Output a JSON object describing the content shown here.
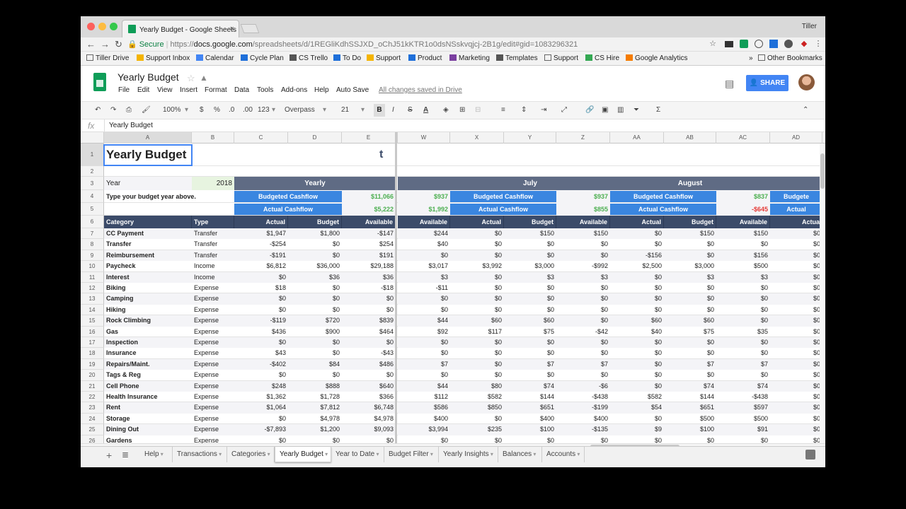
{
  "browser": {
    "tab_title": "Yearly Budget - Google Sheets",
    "profile": "Tiller",
    "secure_label": "Secure",
    "url_scheme": "https://",
    "url_host": "docs.google.com",
    "url_path": "/spreadsheets/d/1REGliKdhSSJXD_oChJ51kKTR1o0dsNSskvqjcj-2B1g/edit#gid=1083296321"
  },
  "bookmarks": [
    "Tiller Drive",
    "Support Inbox",
    "Calendar",
    "Cycle Plan",
    "CS Trello",
    "To Do",
    "Support",
    "Product",
    "Marketing",
    "Templates",
    "Support",
    "CS Hire",
    "Google Analytics"
  ],
  "bookmarks_more": "»",
  "other_bookmarks": "Other Bookmarks",
  "doc": {
    "title": "Yearly Budget",
    "menu": [
      "File",
      "Edit",
      "View",
      "Insert",
      "Format",
      "Data",
      "Tools",
      "Add-ons",
      "Help",
      "Auto Save"
    ],
    "saved": "All changes saved in Drive",
    "share": "SHARE"
  },
  "toolbar": {
    "zoom": "100%",
    "currency": "$",
    "percent": "%",
    "dec_less": ".0",
    "dec_more": ".00",
    "format": "123",
    "font": "Overpass",
    "size": "21",
    "bold": "B",
    "italic": "I",
    "strike": "S",
    "textcolor": "A"
  },
  "formula_bar": {
    "fx": "fx",
    "value": "Yearly Budget"
  },
  "columns": [
    "A",
    "B",
    "C",
    "D",
    "E",
    "W",
    "X",
    "Y",
    "Z",
    "AA",
    "AB",
    "AC",
    "AD"
  ],
  "row_numbers": [
    "1",
    "2",
    "3",
    "4",
    "5",
    "6",
    "7",
    "8",
    "9",
    "10",
    "11",
    "12",
    "13",
    "14",
    "15",
    "16",
    "17",
    "18",
    "19",
    "20",
    "21",
    "22",
    "23",
    "24",
    "25",
    "26"
  ],
  "sheet": {
    "title": "Yearly Budget",
    "logo": "t",
    "year_label": "Year",
    "year_value": "2018",
    "hint": "Type your budget year above.",
    "section_yearly": "Yearly",
    "section_july": "July",
    "section_august": "August",
    "budgeted_cashflow": "Budgeted Cashflow",
    "actual_cashflow": "Actual Cashflow",
    "budgeted_trunc": "Budgete",
    "actual_trunc": "Actual",
    "yearly_budgeted_val": "$11,066",
    "yearly_actual_val": "$5,222",
    "w_budgeted_val": "$937",
    "w_actual_val": "$1,992",
    "july_budgeted_val": "$937",
    "july_actual_val": "$855",
    "aug_budgeted_val": "$837",
    "aug_actual_val": "-$645",
    "headers": [
      "Category",
      "Type",
      "Actual",
      "Budget",
      "Available",
      "Available",
      "Actual",
      "Budget",
      "Available",
      "Actual",
      "Budget",
      "Available",
      "Actua"
    ],
    "rows": [
      [
        "CC Payment",
        "Transfer",
        "$1,947",
        "$1,800",
        "-$147",
        "$244",
        "$0",
        "$150",
        "$150",
        "$0",
        "$150",
        "$150",
        "$0"
      ],
      [
        "Transfer",
        "Transfer",
        "-$254",
        "$0",
        "$254",
        "$40",
        "$0",
        "$0",
        "$0",
        "$0",
        "$0",
        "$0",
        "$0"
      ],
      [
        "Reimbursement",
        "Transfer",
        "-$191",
        "$0",
        "$191",
        "$0",
        "$0",
        "$0",
        "$0",
        "-$156",
        "$0",
        "$156",
        "$0"
      ],
      [
        "Paycheck",
        "Income",
        "$6,812",
        "$36,000",
        "$29,188",
        "$3,017",
        "$3,992",
        "$3,000",
        "-$992",
        "$2,500",
        "$3,000",
        "$500",
        "$0"
      ],
      [
        "Interest",
        "Income",
        "$0",
        "$36",
        "$36",
        "$3",
        "$0",
        "$3",
        "$3",
        "$0",
        "$3",
        "$3",
        "$0"
      ],
      [
        "Biking",
        "Expense",
        "$18",
        "$0",
        "-$18",
        "-$11",
        "$0",
        "$0",
        "$0",
        "$0",
        "$0",
        "$0",
        "$0"
      ],
      [
        "Camping",
        "Expense",
        "$0",
        "$0",
        "$0",
        "$0",
        "$0",
        "$0",
        "$0",
        "$0",
        "$0",
        "$0",
        "$0"
      ],
      [
        "Hiking",
        "Expense",
        "$0",
        "$0",
        "$0",
        "$0",
        "$0",
        "$0",
        "$0",
        "$0",
        "$0",
        "$0",
        "$0"
      ],
      [
        "Rock Climbing",
        "Expense",
        "-$119",
        "$720",
        "$839",
        "$44",
        "$60",
        "$60",
        "$0",
        "$60",
        "$60",
        "$0",
        "$0"
      ],
      [
        "Gas",
        "Expense",
        "$436",
        "$900",
        "$464",
        "$92",
        "$117",
        "$75",
        "-$42",
        "$40",
        "$75",
        "$35",
        "$0"
      ],
      [
        "Inspection",
        "Expense",
        "$0",
        "$0",
        "$0",
        "$0",
        "$0",
        "$0",
        "$0",
        "$0",
        "$0",
        "$0",
        "$0"
      ],
      [
        "Insurance",
        "Expense",
        "$43",
        "$0",
        "-$43",
        "$0",
        "$0",
        "$0",
        "$0",
        "$0",
        "$0",
        "$0",
        "$0"
      ],
      [
        "Repairs/Maint.",
        "Expense",
        "-$402",
        "$84",
        "$486",
        "$7",
        "$0",
        "$7",
        "$7",
        "$0",
        "$7",
        "$7",
        "$0"
      ],
      [
        "Tags & Reg",
        "Expense",
        "$0",
        "$0",
        "$0",
        "$0",
        "$0",
        "$0",
        "$0",
        "$0",
        "$0",
        "$0",
        "$0"
      ],
      [
        "Cell Phone",
        "Expense",
        "$248",
        "$888",
        "$640",
        "$44",
        "$80",
        "$74",
        "-$6",
        "$0",
        "$74",
        "$74",
        "$0"
      ],
      [
        "Health Insurance",
        "Expense",
        "$1,362",
        "$1,728",
        "$366",
        "$112",
        "$582",
        "$144",
        "-$438",
        "$582",
        "$144",
        "-$438",
        "$0"
      ],
      [
        "Rent",
        "Expense",
        "$1,064",
        "$7,812",
        "$6,748",
        "$586",
        "$850",
        "$651",
        "-$199",
        "$54",
        "$651",
        "$597",
        "$0"
      ],
      [
        "Storage",
        "Expense",
        "$0",
        "$4,978",
        "$4,978",
        "$400",
        "$0",
        "$400",
        "$400",
        "$0",
        "$500",
        "$500",
        "$0"
      ],
      [
        "Dining Out",
        "Expense",
        "-$7,893",
        "$1,200",
        "$9,093",
        "$3,994",
        "$235",
        "$100",
        "-$135",
        "$9",
        "$100",
        "$91",
        "$0"
      ],
      [
        "Gardens",
        "Expense",
        "$0",
        "$0",
        "$0",
        "$0",
        "$0",
        "$0",
        "$0",
        "$0",
        "$0",
        "$0",
        "$0"
      ]
    ]
  },
  "sheet_tabs": [
    "Help",
    "Transactions",
    "Categories",
    "Yearly Budget",
    "Year to Date",
    "Budget Filter",
    "Yearly Insights",
    "Balances",
    "Accounts"
  ],
  "active_tab": "Yearly Budget",
  "colors": {
    "navy": "#3b4b69",
    "blue": "#3a86e0",
    "green": "#4caf50",
    "red": "#e53935",
    "sheets_green": "#0f9d58"
  }
}
